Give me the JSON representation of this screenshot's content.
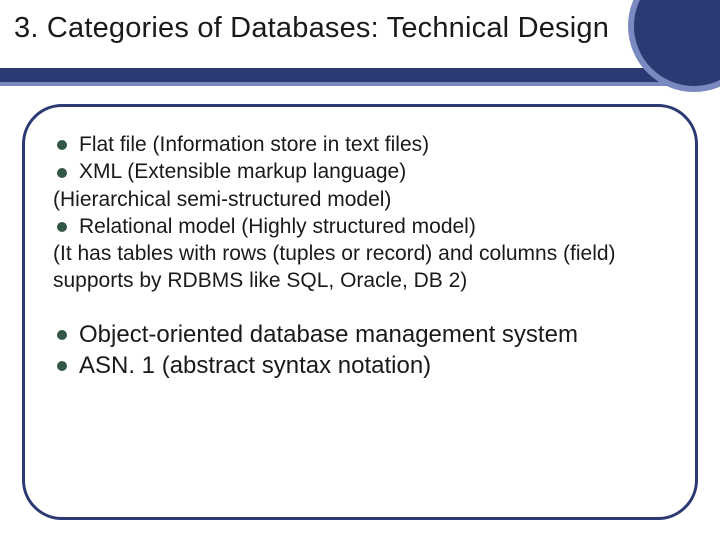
{
  "title": "3. Categories of Databases: Technical Design",
  "block1": {
    "b1": "Flat file (Information store in text files)",
    "b2": "XML (Extensible markup language)",
    "p1": "(Hierarchical semi-structured model)",
    "b3": "Relational model (Highly structured model)",
    "p2": "(It has tables with rows (tuples or record) and columns (field) supports by RDBMS like SQL, Oracle, DB 2)"
  },
  "block2": {
    "b1": "Object-oriented database management system",
    "b2": "ASN. 1 (abstract syntax notation)"
  }
}
